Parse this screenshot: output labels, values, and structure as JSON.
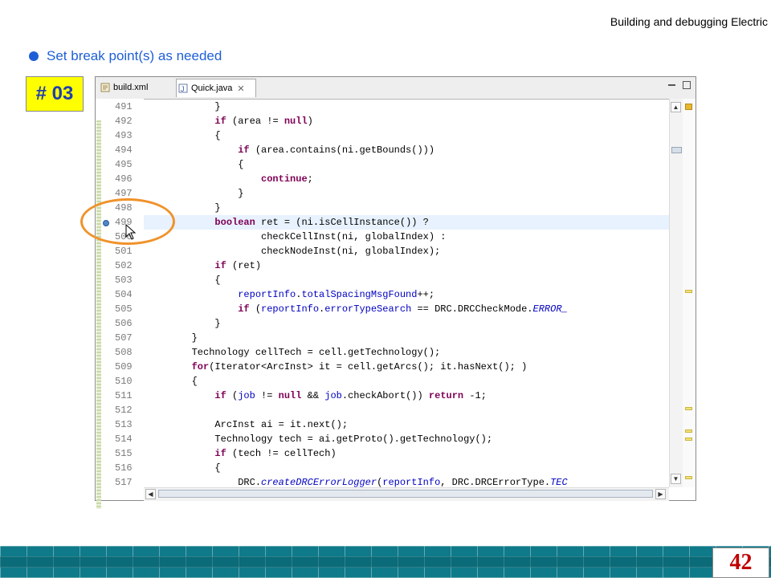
{
  "header": {
    "title": "Building and debugging Electric"
  },
  "bullet": {
    "text": "Set break point(s) as needed"
  },
  "badge": {
    "label": "# 03"
  },
  "editor": {
    "tabs": [
      {
        "label": "build.xml",
        "icon": "xml-file-icon"
      },
      {
        "label": "Quick.java",
        "icon": "java-file-icon",
        "active": true
      }
    ],
    "current_line": "499",
    "breakpoint_line": "499",
    "lines": [
      {
        "num": "491",
        "code": "            }"
      },
      {
        "num": "492",
        "code": "            if (area != null)"
      },
      {
        "num": "493",
        "code": "            {"
      },
      {
        "num": "494",
        "code": "                if (area.contains(ni.getBounds()))"
      },
      {
        "num": "495",
        "code": "                {"
      },
      {
        "num": "496",
        "code": "                    continue;"
      },
      {
        "num": "497",
        "code": "                }"
      },
      {
        "num": "498",
        "code": "            }"
      },
      {
        "num": "499",
        "code": "            boolean ret = (ni.isCellInstance()) ?"
      },
      {
        "num": "500",
        "code": "                    checkCellInst(ni, globalIndex) :"
      },
      {
        "num": "501",
        "code": "                    checkNodeInst(ni, globalIndex);"
      },
      {
        "num": "502",
        "code": "            if (ret)"
      },
      {
        "num": "503",
        "code": "            {"
      },
      {
        "num": "504",
        "code": "                reportInfo.totalSpacingMsgFound++;"
      },
      {
        "num": "505",
        "code": "                if (reportInfo.errorTypeSearch == DRC.DRCCheckMode.ERROR_"
      },
      {
        "num": "506",
        "code": "            }"
      },
      {
        "num": "507",
        "code": "        }"
      },
      {
        "num": "508",
        "code": "        Technology cellTech = cell.getTechnology();"
      },
      {
        "num": "509",
        "code": "        for(Iterator<ArcInst> it = cell.getArcs(); it.hasNext(); )"
      },
      {
        "num": "510",
        "code": "        {"
      },
      {
        "num": "511",
        "code": "            if (job != null && job.checkAbort()) return -1;"
      },
      {
        "num": "512",
        "code": ""
      },
      {
        "num": "513",
        "code": "            ArcInst ai = it.next();"
      },
      {
        "num": "514",
        "code": "            Technology tech = ai.getProto().getTechnology();"
      },
      {
        "num": "515",
        "code": "            if (tech != cellTech)"
      },
      {
        "num": "516",
        "code": "            {"
      },
      {
        "num": "517",
        "code": "                DRC.createDRCErrorLogger(reportInfo, DRC.DRCErrorType.TEC"
      }
    ]
  },
  "footer": {
    "page_number": "42"
  },
  "colors": {
    "keyword": "#7f0055",
    "field": "#0000c0",
    "current_line_bg": "#e8f2fe",
    "callout": "#f0922b",
    "badge_bg": "#ffff00",
    "bullet": "#1f5fd6",
    "footer": "#0f7a8a",
    "page_number": "#c00000"
  }
}
